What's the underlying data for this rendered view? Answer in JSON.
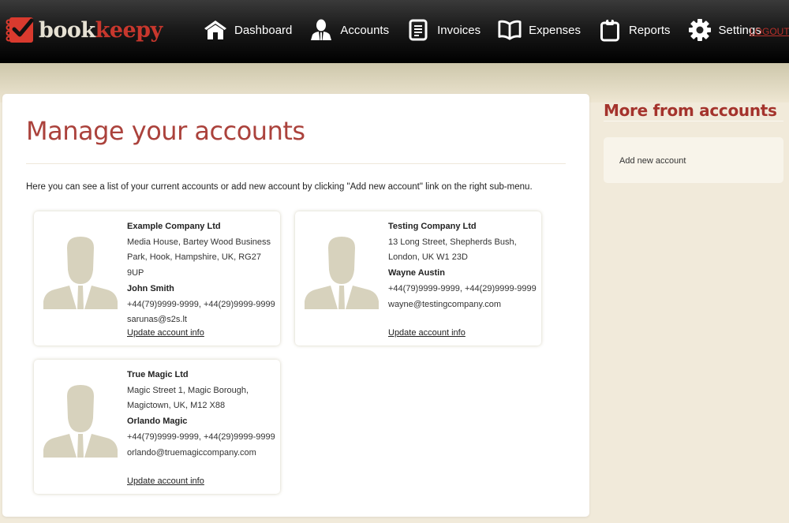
{
  "brand": {
    "name_part1": "book",
    "name_part2": "keepy",
    "accent": "#c8372d"
  },
  "nav": {
    "items": [
      {
        "label": "Dashboard",
        "icon": "home-icon"
      },
      {
        "label": "Accounts",
        "icon": "user-icon"
      },
      {
        "label": "Invoices",
        "icon": "document-icon"
      },
      {
        "label": "Expenses",
        "icon": "book-icon"
      },
      {
        "label": "Reports",
        "icon": "clipboard-icon"
      },
      {
        "label": "Settings",
        "icon": "gear-icon"
      }
    ],
    "logout_label": "LOGOUT"
  },
  "main": {
    "title": "Manage your accounts",
    "intro": "Here you can see a list of your current accounts or add new account by clicking \"Add new account\" link on the right sub-menu.",
    "accounts": [
      {
        "company": "Example Company Ltd",
        "address_line1": "Media House, Bartey Wood Business",
        "address_line2": "Park, Hook, Hampshire, UK, RG27 9UP",
        "contact": "John Smith",
        "phones": "+44(79)9999-9999, +44(29)9999-9999",
        "email": "sarunas@s2s.lt",
        "update_label": "Update account info"
      },
      {
        "company": "Testing Company Ltd",
        "address_line1": "13 Long Street, Shepherds Bush,",
        "address_line2": "London, UK W1 23D",
        "contact": "Wayne Austin",
        "phones": "+44(79)9999-9999, +44(29)9999-9999",
        "email": "wayne@testingcompany.com",
        "update_label": "Update account info"
      },
      {
        "company": "True Magic Ltd",
        "address_line1": "Magic Street 1, Magic Borough,",
        "address_line2": "Magictown, UK, M12 X88",
        "contact": "Orlando Magic",
        "phones": "+44(79)9999-9999, +44(29)9999-9999",
        "email": "orlando@truemagiccompany.com",
        "update_label": "Update account info"
      }
    ]
  },
  "sidebar": {
    "title": "More from accounts",
    "links": [
      {
        "label": "Add new account"
      }
    ]
  }
}
